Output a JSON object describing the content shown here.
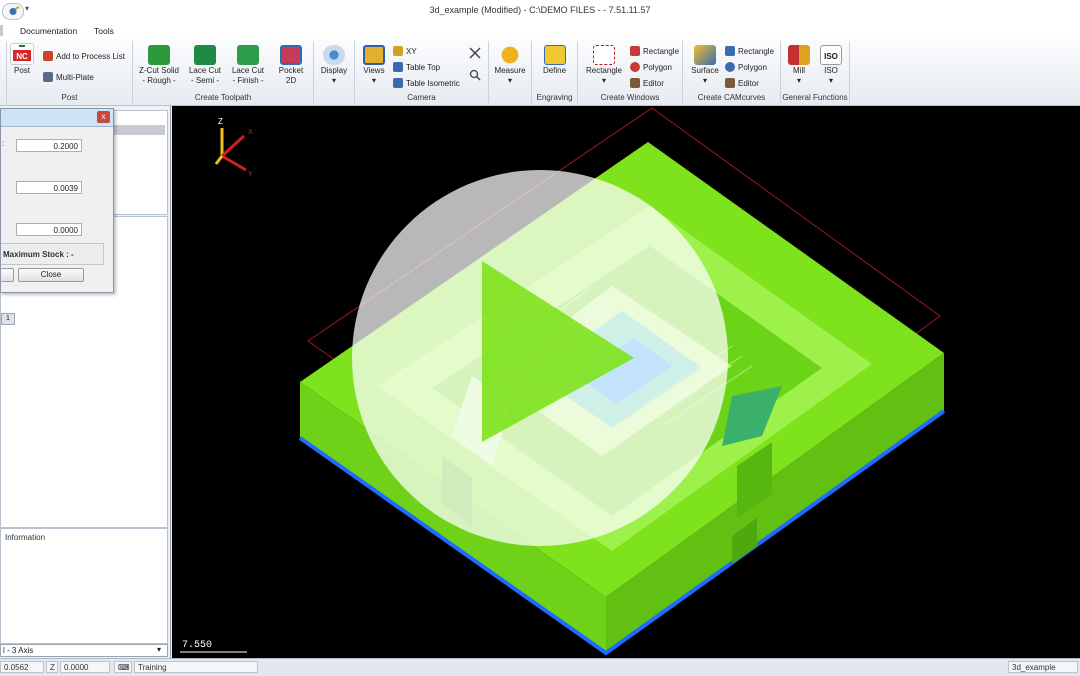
{
  "window": {
    "title": "3d_example (Modified)  -  C:\\DEMO FILES -  - 7.51.11.57"
  },
  "menu": {
    "items": [
      "Documentation",
      "Tools"
    ]
  },
  "ribbon": {
    "post": {
      "post_label": "Post",
      "add_label": "Add to Process List",
      "multi_label": "Multi-Plate",
      "group": "Post"
    },
    "toolpath": {
      "group": "Create Toolpath",
      "zcut_l1": "Z-Cut Solid",
      "zcut_l2": "- Rough -",
      "lace_semi_l1": "Lace Cut",
      "lace_semi_l2": "- Semi -",
      "lace_finish_l1": "Lace Cut",
      "lace_finish_l2": "- Finish -",
      "pocket_l1": "Pocket",
      "pocket_l2": "2D"
    },
    "display": {
      "label": "Display"
    },
    "camera": {
      "group": "Camera",
      "views_label": "Views",
      "xy": "XY",
      "table_top": "Table Top",
      "table_iso": "Table Isometric"
    },
    "measure": {
      "label": "Measure"
    },
    "engraving": {
      "group": "Engraving",
      "define": "Define"
    },
    "windows": {
      "group": "Create Windows",
      "rectangle_big": "Rectangle",
      "rectangle": "Rectangle",
      "polygon": "Polygon",
      "editor": "Editor"
    },
    "camcurves": {
      "group": "Create CAMcurves",
      "surface": "Surface",
      "rectangle": "Rectangle",
      "polygon": "Polygon",
      "editor": "Editor"
    },
    "general": {
      "group": "General Functions",
      "mill": "Mill",
      "iso": "ISO"
    }
  },
  "dialog": {
    "fields": [
      "0.2000",
      "0.0039",
      "0.0000"
    ],
    "max_stock_label": "Maximum Stock : -",
    "close_label": "Close"
  },
  "left": {
    "tree_tag": "1",
    "info_header": "Information",
    "machine_select": "l - 3 Axis"
  },
  "viewport": {
    "axis_z": "Z",
    "axis_x": "X",
    "axis_y": "Y",
    "scale_value": "7.550",
    "colors": {
      "part": "#7ee21c",
      "bottom_edge": "#1e6cff",
      "bbox": "#a31818"
    }
  },
  "status": {
    "x": "0.0562",
    "z_label": "Z",
    "z": "0.0000",
    "mode": "Training",
    "file": "3d_example"
  }
}
